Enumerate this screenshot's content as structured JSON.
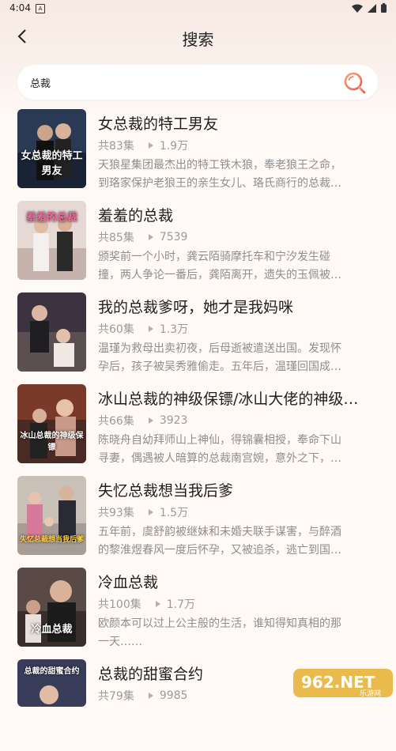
{
  "status": {
    "time": "4:04",
    "a_icon": "A"
  },
  "header": {
    "title": "搜索",
    "back_icon": "chevron-left-icon"
  },
  "search": {
    "value": "总裁",
    "icon": "search-icon"
  },
  "items": [
    {
      "title": "女总裁的特工男友",
      "episodes": "共83集",
      "views": "1.9万",
      "desc1": "天狼星集团最杰出的特工铁木狼，奉老狼王之命，",
      "desc2": "到珞家保护老狼王的亲生女儿、珞氏商行的总裁…",
      "cover_text": "女总裁的特工男友",
      "cover_color": "#2a3a55"
    },
    {
      "title": "羞羞的总裁",
      "episodes": "共85集",
      "views": "7539",
      "desc1": "颁奖前一个小时，龚云陌骑摩托车和宁汐发生碰",
      "desc2": "撞，两人争论一番后，龚陌离开，遗失的玉佩被…",
      "cover_text": "羞羞的总裁",
      "cover_color": "#d9c7c0"
    },
    {
      "title": "我的总裁爹呀，她才是我妈咪",
      "episodes": "共60集",
      "views": "1.3万",
      "desc1": "温瑾为救母出卖初夜，后母逝被遣送出国。发现怀",
      "desc2": "孕后，孩子被吴秀雅偷走。五年后，温瑾回国成…",
      "cover_text": "",
      "cover_color": "#3b3340"
    },
    {
      "title": "冰山总裁的神级保镖/冰山大佬的神级…",
      "episodes": "共66集",
      "views": "3923",
      "desc1": "陈晓舟自幼拜师山上神仙，得锦囊相授，奉命下山",
      "desc2": "寻妻，偶遇被人暗算的总裁南宫婉，意外之下，…",
      "cover_text": "冰山总裁的神级保镖",
      "cover_color": "#7a3a2a"
    },
    {
      "title": "失忆总裁想当我后爹",
      "episodes": "共93集",
      "views": "1.5万",
      "desc1": "五年前，虞舒韵被继妹和未婚夫联手谋害，与醉酒",
      "desc2": "的黎淮煜春风一度后怀孕，又被追杀，逃亡到国…",
      "cover_text": "失忆总裁想当我后爹",
      "cover_color": "#c9c0b8"
    },
    {
      "title": "冷血总裁",
      "episodes": "共100集",
      "views": "1.7万",
      "desc1": "欧颜本可以过上公主般的生活，谁知得知真相的那",
      "desc2": "一天……",
      "cover_text": "冷血总裁",
      "cover_color": "#5a4a45"
    },
    {
      "title": "总裁的甜蜜合约",
      "episodes": "共79集",
      "views": "9985",
      "desc1": "",
      "desc2": "",
      "cover_text": "总裁的甜蜜合约",
      "cover_color": "#3a3d5a"
    }
  ],
  "watermark": {
    "main": "962.NET",
    "sub": "乐游网"
  },
  "colors": {
    "accent": "#f06a4a",
    "title": "#1f1f1f",
    "muted": "#9a9a9a"
  }
}
